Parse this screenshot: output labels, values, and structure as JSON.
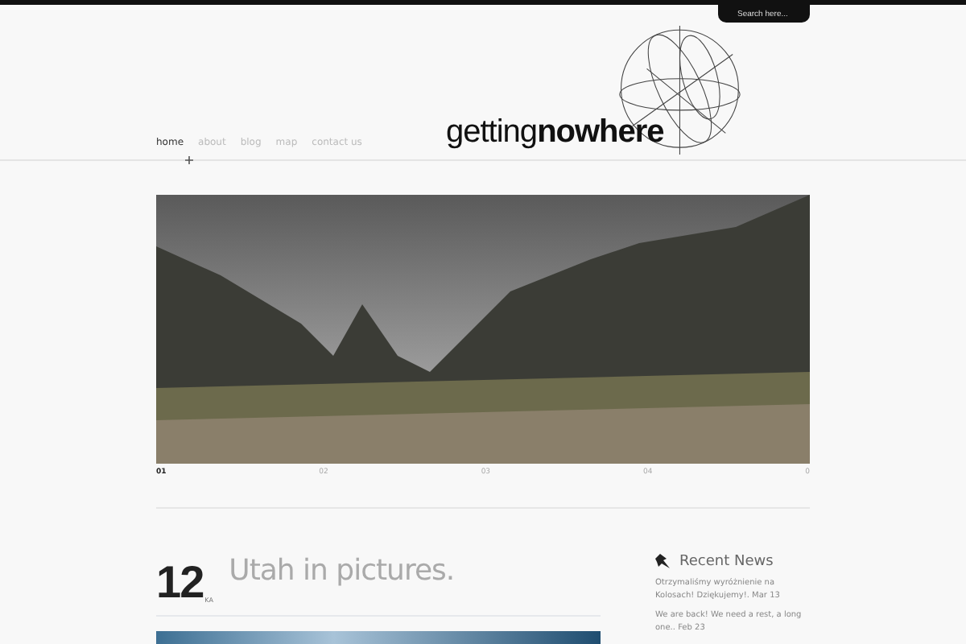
{
  "search": {
    "placeholder": "Search here..."
  },
  "nav": [
    {
      "label": "home",
      "selected": true
    },
    {
      "label": "about",
      "selected": false
    },
    {
      "label": "blog",
      "selected": false
    },
    {
      "label": "map",
      "selected": false
    },
    {
      "label": "contact us",
      "selected": false
    }
  ],
  "logo": {
    "light": "getting",
    "bold": "nowhere"
  },
  "slider": [
    {
      "label": "01",
      "selected": true
    },
    {
      "label": "02",
      "selected": false
    },
    {
      "label": "03",
      "selected": false
    },
    {
      "label": "04",
      "selected": false
    },
    {
      "label": "0",
      "selected": false
    }
  ],
  "post": {
    "day": "12",
    "month": "KA",
    "title": "Utah in pictures."
  },
  "sidebar": {
    "title": "Recent News",
    "items": [
      "Otrzymaliśmy wyróżnienie na Kolosach! Dziękujemy!. Mar 13",
      "We are back! We need a rest, a long one.. Feb 23"
    ]
  }
}
